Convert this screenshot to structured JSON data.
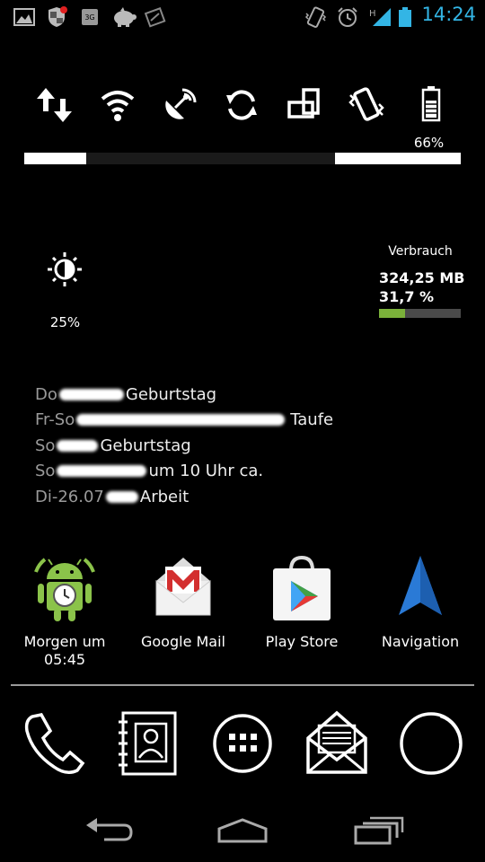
{
  "status_bar": {
    "left_icons": [
      "gallery-icon",
      "shield-icon",
      "gps-icon",
      "piggy-bank-icon",
      "tool-icon"
    ],
    "right_icons": [
      "vibrate-icon",
      "alarm-icon",
      "signal-h-icon",
      "battery-icon"
    ],
    "network_type": "H",
    "time": "14:24",
    "accent_color": "#33b5e5"
  },
  "power_widget": {
    "toggles": [
      "data-toggle-icon",
      "wifi-icon",
      "gps-toggle-icon",
      "sync-icon",
      "rotation-icon",
      "vibrate-toggle-icon",
      "battery-status-icon"
    ],
    "battery_percent": "66%"
  },
  "brightness": {
    "percent": "25%"
  },
  "usage": {
    "title": "Verbrauch",
    "amount": "324,25 MB",
    "percent": "31,7 %",
    "fraction": 0.317,
    "fill_color": "#7bb13a"
  },
  "calendar": {
    "events": [
      {
        "day": "Do",
        "title": "Geburtstag",
        "blur_width": 60
      },
      {
        "day": "Fr-So",
        "title": "Taufe",
        "blur_width": 232
      },
      {
        "day": "So",
        "title": "Geburtstag",
        "blur_width": 46
      },
      {
        "day": "So",
        "title": "um 10 Uhr ca.",
        "blur_width": 100
      },
      {
        "day": "Di-26.07",
        "title": "Arbeit",
        "blur_width": 36
      }
    ]
  },
  "apps": [
    {
      "icon": "android-clock-icon",
      "label": "Morgen um\n05:45"
    },
    {
      "icon": "gmail-icon",
      "label": "Google Mail"
    },
    {
      "icon": "play-store-icon",
      "label": "Play Store"
    },
    {
      "icon": "navigation-icon",
      "label": "Navigation"
    }
  ],
  "dock": {
    "items": [
      "phone-icon",
      "contacts-icon",
      "app-drawer-icon",
      "messaging-icon",
      "browser-icon"
    ]
  },
  "nav_bar": {
    "items": [
      "back-icon",
      "home-icon",
      "recent-apps-icon"
    ]
  }
}
